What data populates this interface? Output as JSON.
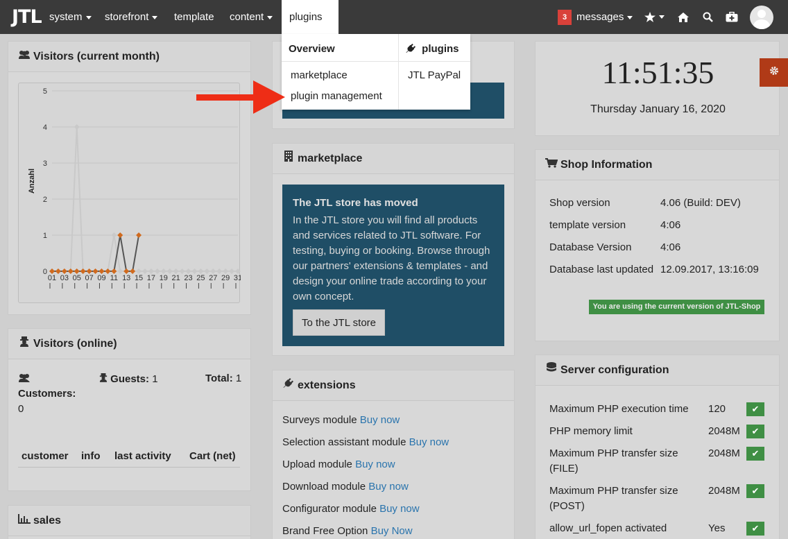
{
  "nav": {
    "logo": "JTL",
    "items": [
      "system",
      "storefront",
      "template",
      "content",
      "plugins"
    ],
    "messages_count": "3",
    "messages_label": "messages"
  },
  "dropdown": {
    "col1_head": "Overview",
    "col2_head": "plugins",
    "col1_items": [
      "marketplace",
      "plugin management"
    ],
    "col2_items": [
      "JTL PayPal"
    ]
  },
  "visitors_month": {
    "title": "Visitors (current month)"
  },
  "chart_data": {
    "type": "line",
    "ylabel": "Anzahl",
    "ylim": [
      0,
      5
    ],
    "yticks": [
      "5",
      "4",
      "3",
      "2",
      "1",
      "0"
    ],
    "xticks": [
      "01",
      "03",
      "05",
      "07",
      "09",
      "11",
      "13",
      "15",
      "17",
      "19",
      "21",
      "23",
      "25",
      "27",
      "29",
      "31"
    ],
    "x": [
      1,
      2,
      3,
      4,
      5,
      6,
      7,
      8,
      9,
      10,
      11,
      12,
      13,
      14,
      15,
      16,
      17,
      18,
      19,
      20,
      21,
      22,
      23,
      24,
      25,
      26,
      27,
      28,
      29,
      30,
      31
    ],
    "series": [
      {
        "color": "#c9c9c9",
        "values": [
          0,
          0,
          0,
          0,
          4,
          0,
          0,
          0,
          0,
          0,
          1,
          0,
          0,
          0,
          0,
          0,
          0,
          0,
          0,
          0,
          0,
          0,
          0,
          0,
          0,
          0,
          0,
          0,
          0,
          0,
          0
        ]
      },
      {
        "color": "#d06a1e",
        "values": [
          0,
          0,
          0,
          0,
          0,
          0,
          0,
          0,
          0,
          0,
          0,
          1,
          0,
          0,
          1,
          null,
          null,
          null,
          null,
          null,
          null,
          null,
          null,
          null,
          null,
          null,
          null,
          null,
          null,
          null,
          null
        ]
      }
    ]
  },
  "visitors_online": {
    "title": "Visitors (online)",
    "customers_label": "Customers:",
    "customers_value": "0",
    "guests_label": "Guests:",
    "guests_value": "1",
    "total_label": "Total:",
    "total_value": "1",
    "columns": [
      "customer",
      "info",
      "last activity",
      "Cart (net)"
    ]
  },
  "sales": {
    "title": "sales"
  },
  "clock": {
    "time": "11:51:35",
    "date": "Thursday January 16, 2020"
  },
  "marketplace": {
    "title": "marketplace",
    "heading": "The JTL store has moved",
    "text": "In the JTL store you will find all products and services related to JTL software. For testing, buying or booking. Browse through our partners' extensions & templates - and design your online trade according to your own concept.",
    "button": "To the JTL store"
  },
  "extensions": {
    "title": "extensions",
    "items": [
      {
        "name": "Surveys module",
        "link": "Buy now"
      },
      {
        "name": "Selection assistant module",
        "link": "Buy now"
      },
      {
        "name": "Upload module",
        "link": "Buy now"
      },
      {
        "name": "Download module",
        "link": "Buy now"
      },
      {
        "name": "Configurator module",
        "link": "Buy now"
      },
      {
        "name": "Brand Free Option",
        "link": "Buy Now"
      }
    ]
  },
  "shop_info": {
    "title": "Shop Information",
    "rows": [
      {
        "label": "Shop version",
        "value": "4.06 (Build: DEV)"
      },
      {
        "label": "template version",
        "value": "4:06"
      },
      {
        "label": "Database Version",
        "value": "4:06"
      },
      {
        "label": "Database last updated",
        "value": "12.09.2017, 13:16:09"
      }
    ],
    "status": "You are using the current version of JTL-Shop"
  },
  "server_config": {
    "title": "Server configuration",
    "rows": [
      {
        "label": "Maximum PHP execution time",
        "value": "120"
      },
      {
        "label": "PHP memory limit",
        "value": "2048M"
      },
      {
        "label": "Maximum PHP transfer size (FILE)",
        "value": "2048M"
      },
      {
        "label": "Maximum PHP transfer size (POST)",
        "value": "2048M"
      },
      {
        "label": "allow_url_fopen activated",
        "value": "Yes"
      }
    ]
  }
}
